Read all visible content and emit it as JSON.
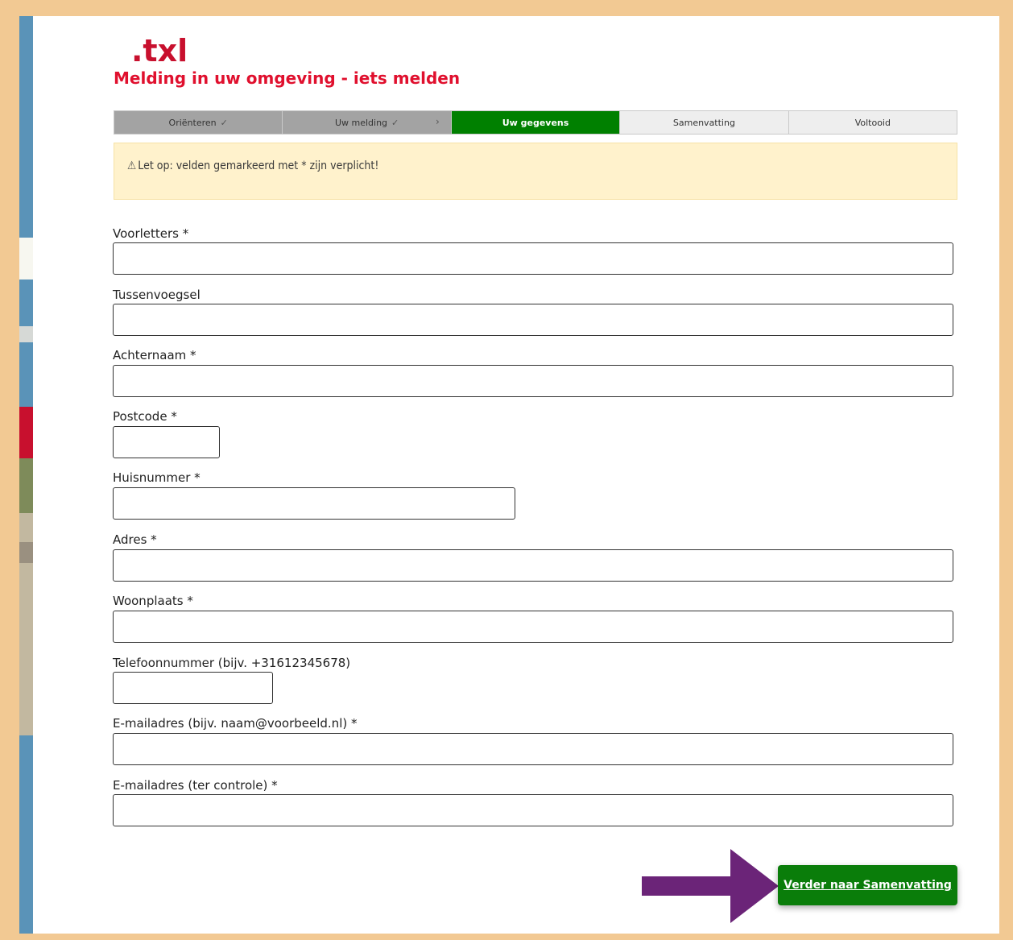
{
  "brand": {
    "logo": ".txl",
    "title": "Melding in uw omgeving - iets melden"
  },
  "steps": [
    {
      "label": "Oriënteren",
      "state": "done"
    },
    {
      "label": "Uw melding",
      "state": "done"
    },
    {
      "label": "Uw gegevens",
      "state": "current"
    },
    {
      "label": "Samenvatting",
      "state": "todo"
    },
    {
      "label": "Voltooid",
      "state": "todo"
    }
  ],
  "notice": {
    "icon": "warning-triangle-icon",
    "text": "Let op: velden gemarkeerd met * zijn verplicht!"
  },
  "fields": [
    {
      "label": "Voorletters *",
      "value": ""
    },
    {
      "label": "Tussenvoegsel",
      "value": ""
    },
    {
      "label": "Achternaam *",
      "value": ""
    },
    {
      "label": "Postcode *",
      "value": ""
    },
    {
      "label": "Huisnummer *",
      "value": ""
    },
    {
      "label": "Adres *",
      "value": ""
    },
    {
      "label": "Woonplaats *",
      "value": ""
    },
    {
      "label": "Telefoonnummer (bijv. +31612345678)",
      "value": ""
    },
    {
      "label": "E-mailadres (bijv. naam@voorbeeld.nl) *",
      "value": ""
    },
    {
      "label": "E-mailadres (ter controle) *",
      "value": ""
    }
  ],
  "next_button": {
    "label": "Verder naar Samenvatting"
  },
  "colors": {
    "brand_red": "#c8102e",
    "step_current": "#008000",
    "step_done": "#a3a3a3",
    "notice_bg": "#fff2cc",
    "button_green": "#0a7d0a",
    "arrow_purple": "#6b2478",
    "outer_frame": "#f2c993"
  }
}
